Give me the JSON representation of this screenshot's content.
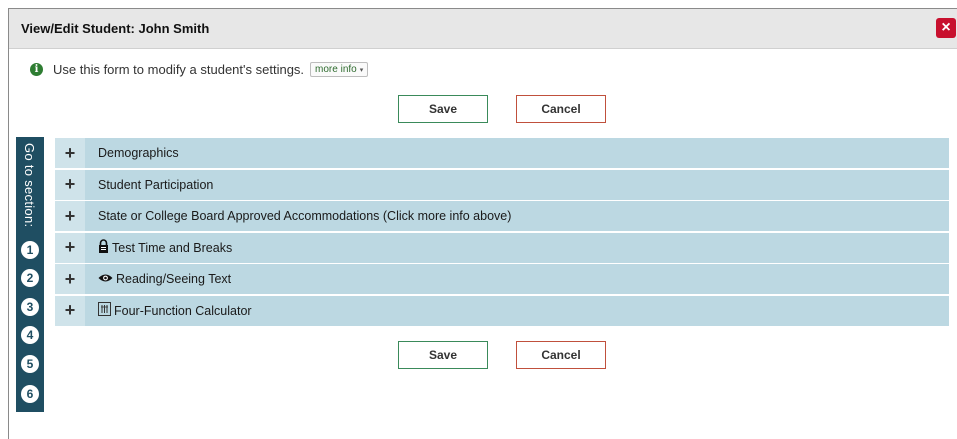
{
  "dialog": {
    "title": "View/Edit Student: John Smith",
    "close_label": "×"
  },
  "info": {
    "text": "Use this form to modify a student's settings.",
    "more_info": "more info",
    "more_info_caret": "▾",
    "icon_glyph": "i"
  },
  "actions": {
    "save_label": "Save",
    "cancel_label": "Cancel"
  },
  "nav": {
    "label": "Go to section:",
    "items": [
      "1",
      "2",
      "3",
      "4",
      "5",
      "6"
    ]
  },
  "sections": [
    {
      "label": "Demographics",
      "icon": ""
    },
    {
      "label": "Student Participation",
      "icon": ""
    },
    {
      "label": "State or College Board Approved Accommodations (Click more info above)",
      "icon": ""
    },
    {
      "label": "Test Time and Breaks",
      "icon": "lock-icon"
    },
    {
      "label": "Reading/Seeing Text",
      "icon": "eye-icon"
    },
    {
      "label": "Four-Function Calculator",
      "icon": "calculator-icon"
    }
  ],
  "colors": {
    "close": "#c8102e",
    "nav_bg": "#1f4e62",
    "section_bg": "#bcd8e2",
    "save_border": "#3a8a5a",
    "cancel_border": "#c0503c"
  }
}
